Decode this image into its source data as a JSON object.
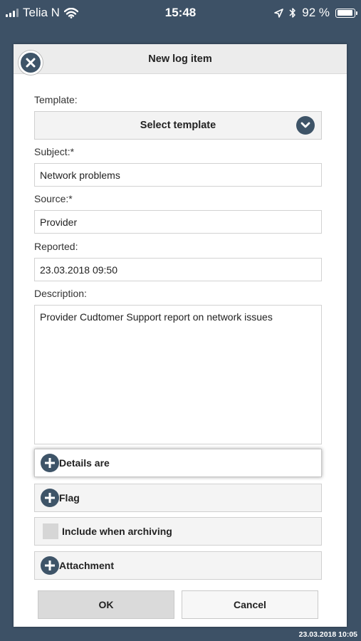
{
  "status_bar": {
    "carrier": "Telia N",
    "time": "15:48",
    "battery": "92 %",
    "battery_level": 0.92
  },
  "dialog": {
    "title": "New log item",
    "template_label": "Template:",
    "template_value": "Select template",
    "subject_label": "Subject:*",
    "subject_value": "Network problems",
    "source_label": "Source:*",
    "source_value": "Provider",
    "reported_label": "Reported:",
    "reported_value": "23.03.2018 09:50",
    "description_label": "Description:",
    "description_value": "Provider Cudtomer Support report on network issues",
    "sections": {
      "details": "Details are",
      "flag": "Flag",
      "include_archiving": "Include when archiving",
      "attachment": "Attachment"
    },
    "ok_label": "OK",
    "cancel_label": "Cancel"
  },
  "footer": {
    "timestamp": "23.03.2018 10:05"
  },
  "colors": {
    "background": "#3d5166",
    "accent": "#3e5468"
  },
  "icons": [
    "signal-icon",
    "wifi-icon",
    "location-icon",
    "bluetooth-icon",
    "battery-icon",
    "close-icon",
    "chevron-down-icon",
    "plus-icon"
  ]
}
